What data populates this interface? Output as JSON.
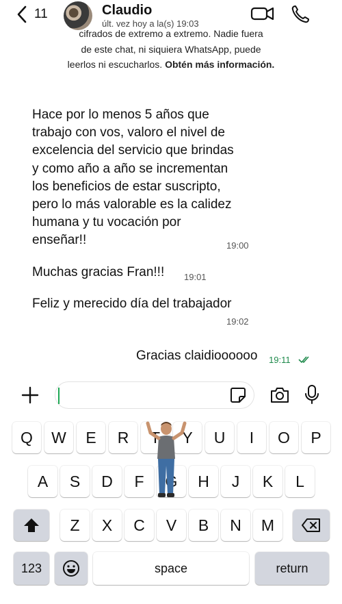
{
  "header": {
    "back_count": "11",
    "contact_name": "Claudio",
    "status": "últ. vez hoy a la(s) 19:03"
  },
  "notice": {
    "line1": "cifrados de extremo a extremo. Nadie fuera",
    "line2": "de este chat, ni siquiera WhatsApp, puede",
    "line3": "leerlos ni escucharlos.",
    "link": "Obtén más información."
  },
  "messages": {
    "received": [
      {
        "lines": [
          "Hace por lo menos 5 años que",
          "trabajo con vos, valoro el nivel de",
          "excelencia del servicio que brindas",
          "y como año a año se incrementan",
          "los beneficios de estar suscripto,",
          "pero lo más valorable es la calidez",
          "humana y tu vocación por",
          "enseñar!!"
        ],
        "time": "19:00"
      },
      {
        "text": "Muchas gracias Fran!!!",
        "time": "19:01"
      },
      {
        "text": "Feliz y merecido día del trabajador",
        "time": "19:02"
      }
    ],
    "sent": {
      "text": "Gracias claidioooooo",
      "time": "19:11"
    }
  },
  "input": {
    "placeholder": ""
  },
  "keyboard": {
    "row1": [
      "Q",
      "W",
      "E",
      "R",
      "T",
      "Y",
      "U",
      "I",
      "O",
      "P"
    ],
    "row2": [
      "A",
      "S",
      "D",
      "F",
      "G",
      "H",
      "J",
      "K",
      "L"
    ],
    "row3": [
      "Z",
      "X",
      "C",
      "V",
      "B",
      "N",
      "M"
    ],
    "numbers_label": "123",
    "space_label": "space",
    "return_label": "return"
  },
  "colors": {
    "sent_time": "#1f8a4c",
    "cursor": "#1fa855",
    "dark_key": "#d3d6de"
  },
  "icons": [
    "back-chevron-icon",
    "video-call-icon",
    "phone-icon",
    "plus-icon",
    "sticker-icon",
    "camera-icon",
    "microphone-icon",
    "shift-icon",
    "backspace-icon",
    "emoji-icon",
    "read-ticks-icon"
  ]
}
